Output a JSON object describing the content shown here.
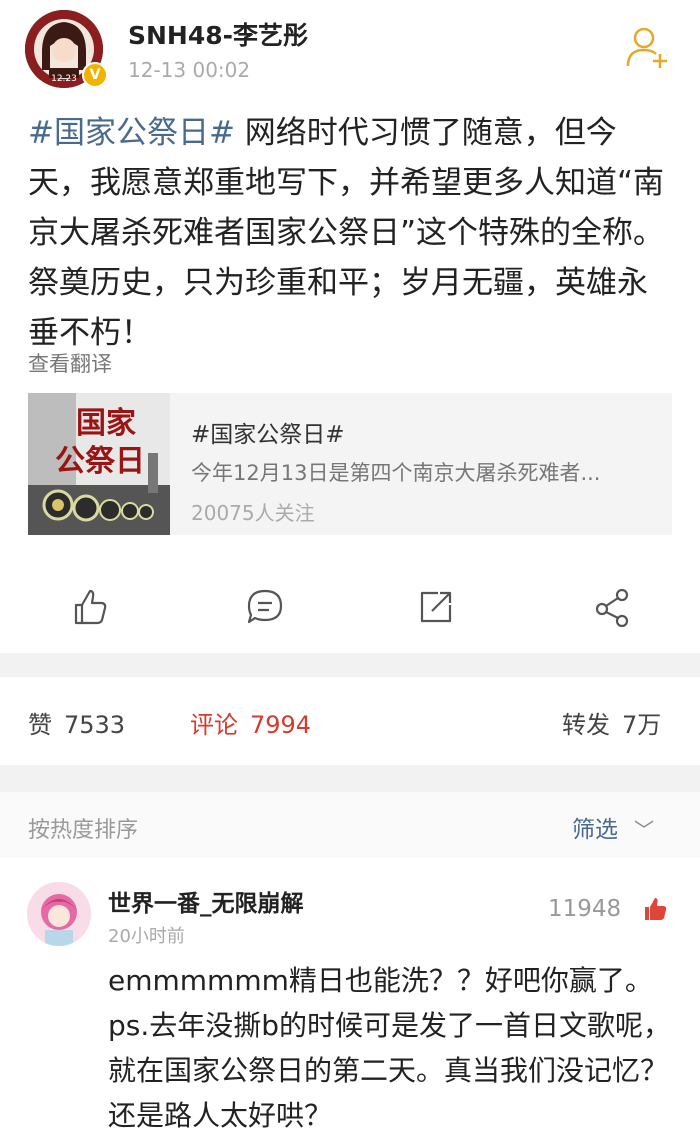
{
  "post": {
    "username": "SNH48-李艺彤",
    "time": "12-13 00:02",
    "hashtag": "#国家公祭日#",
    "text": " 网络时代习惯了随意，但今天，我愿意郑重地写下，并希望更多人知道“南京大屠杀死难者国家公祭日”这个特殊的全称。祭奠历史，只为珍重和平；岁月无疆，英雄永垂不朽！",
    "translate_label": "查看翻译",
    "avatar_badge_text": "12.23"
  },
  "topic_card": {
    "thumb_line1": "国家",
    "thumb_line2": "公祭日",
    "title": "#国家公祭日#",
    "description": "今年12月13日是第四个南京大屠杀死难者...",
    "followers": "20075人关注"
  },
  "actions": {
    "icons": [
      "thumbs-up-icon",
      "comment-icon",
      "share-icon",
      "repost-network-icon"
    ]
  },
  "stats": {
    "likes_label": "赞",
    "likes_count": "7533",
    "comments_label": "评论",
    "comments_count": "7994",
    "reposts_label": "转发",
    "reposts_count": "7万"
  },
  "sort_bar": {
    "sort_label": "按热度排序",
    "filter_label": "筛选"
  },
  "comment": {
    "username": "世界一番_无限崩解",
    "time": "20小时前",
    "likes": "11948",
    "text": "emmmmmm精日也能洗？？好吧你赢了。ps.去年没撕b的时候可是发了一首日文歌呢，就在国家公祭日的第二天。真当我们没记忆？还是路人太好哄？"
  },
  "colors": {
    "link_blue": "#496a8f",
    "accent_red": "#d63a2b",
    "verified_gold": "#f0b400",
    "follow_gold": "#e5a925"
  }
}
